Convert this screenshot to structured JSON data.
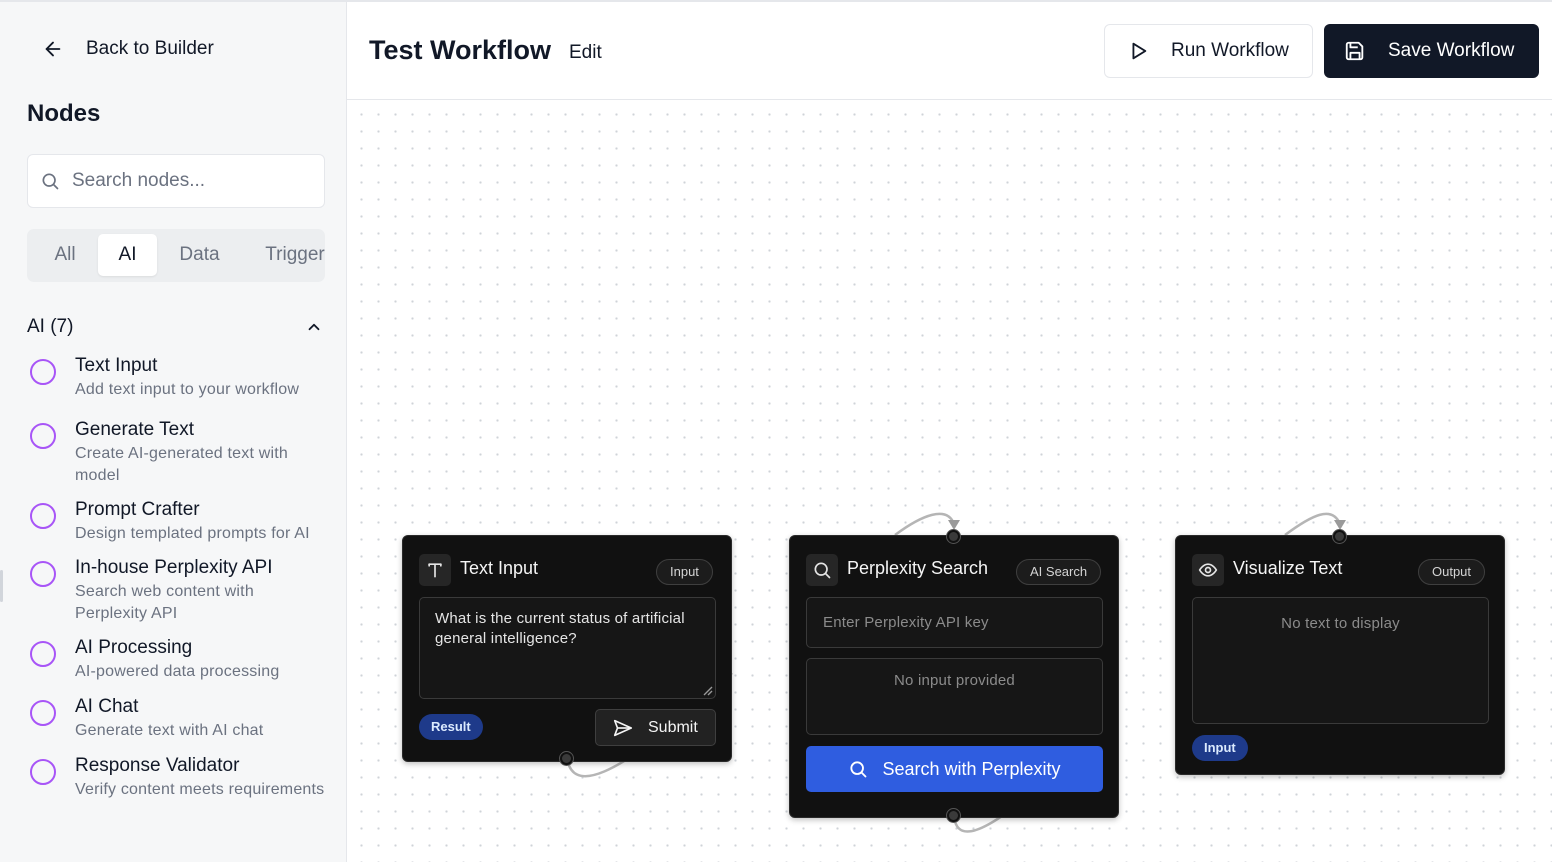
{
  "sidebar": {
    "back_label": "Back to Builder",
    "nodes_title": "Nodes",
    "search_placeholder": "Search nodes...",
    "tabs": [
      {
        "label": "All",
        "active": false
      },
      {
        "label": "AI",
        "active": true
      },
      {
        "label": "Data",
        "active": false
      },
      {
        "label": "Trigger",
        "active": false
      }
    ],
    "group_label": "AI (7)",
    "items": [
      {
        "name": "Text Input",
        "desc": "Add text input to your workflow"
      },
      {
        "name": "Generate Text",
        "desc": "Create AI-generated text with model"
      },
      {
        "name": "Prompt Crafter",
        "desc": "Design templated prompts for AI"
      },
      {
        "name": "In-house Perplexity API",
        "desc": "Search web content with Perplexity API"
      },
      {
        "name": "AI Processing",
        "desc": "AI-powered data processing"
      },
      {
        "name": "AI Chat",
        "desc": "Generate text with AI chat"
      },
      {
        "name": "Response Validator",
        "desc": "Verify content meets requirements"
      }
    ]
  },
  "header": {
    "title": "Test Workflow",
    "edit_label": "Edit",
    "run_label": "Run Workflow",
    "save_label": "Save Workflow"
  },
  "canvas": {
    "text_input_node": {
      "title": "Text Input",
      "badge": "Input",
      "value": "What is the current status of artificial general intelligence?",
      "output_pill": "Result",
      "submit_label": "Submit"
    },
    "perplexity_node": {
      "title": "Perplexity Search",
      "badge": "AI Search",
      "api_key_placeholder": "Enter Perplexity API key",
      "no_input": "No input provided",
      "search_label": "Search with Perplexity"
    },
    "visualize_node": {
      "title": "Visualize Text",
      "badge": "Output",
      "no_text": "No text to display",
      "input_pill": "Input"
    }
  },
  "colors": {
    "accent_purple": "#a855f7",
    "primary_dark": "#111827",
    "search_blue": "#2f5de0",
    "pill_blue": "#1e3a8a"
  }
}
